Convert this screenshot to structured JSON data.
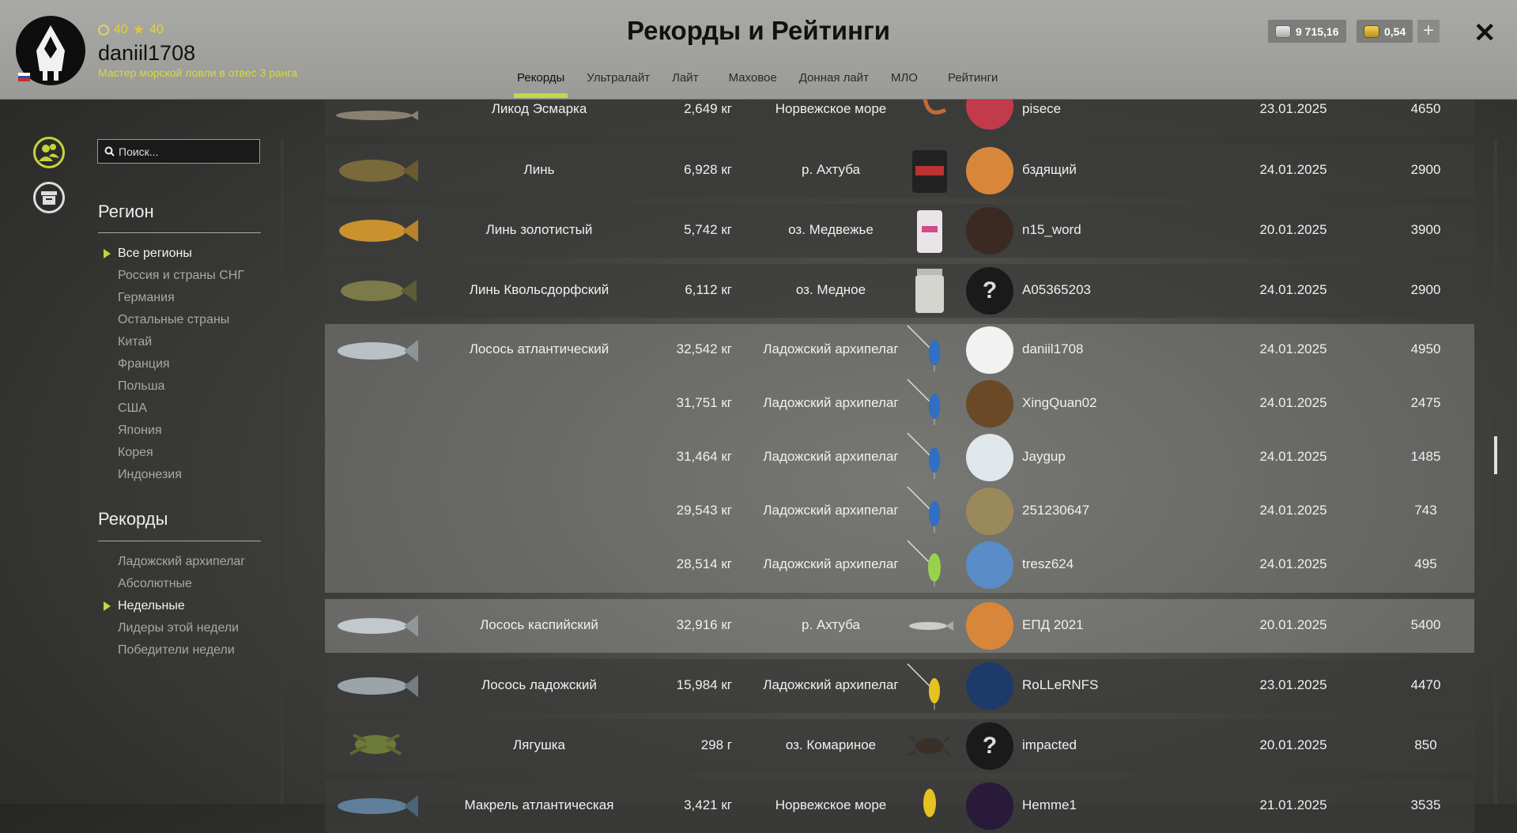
{
  "colors": {
    "accent": "#c6d33f",
    "header_bg": "#9f9f9c",
    "row_bg": "#3c3c3a"
  },
  "header": {
    "title": "Рекорды и Рейтинги",
    "level": "40",
    "stars": "40",
    "username": "daniil1708",
    "rank": "Мастер морской ловли в отвес 3 ранга",
    "silver": "9 715,16",
    "gold": "0,54",
    "plus_label": "+",
    "close_label": "✕",
    "tabs": [
      "Рекорды",
      "Ультралайт",
      "Лайт",
      "Маховое",
      "Донная лайт",
      "МЛО",
      "Рейтинги"
    ]
  },
  "sidebar": {
    "search_placeholder": "Поиск...",
    "region_title": "Регион",
    "regions": [
      "Все регионы",
      "Россия и страны СНГ",
      "Германия",
      "Остальные страны",
      "Китай",
      "Франция",
      "Польша",
      "США",
      "Япония",
      "Корея",
      "Индонезия"
    ],
    "records_title": "Рекорды",
    "records": [
      "Ладожский архипелаг",
      "Абсолютные",
      "Недельные",
      "Лидеры этой недели",
      "Победители недели"
    ]
  },
  "rows": [
    {
      "fish": "Ликод Эсмарка",
      "weight": "2,649 кг",
      "place": "Норвежское море",
      "player": "pisece",
      "date": "23.01.2025",
      "score": "4650"
    },
    {
      "fish": "Линь",
      "weight": "6,928 кг",
      "place": "р. Ахтуба",
      "player": "бздящий",
      "date": "24.01.2025",
      "score": "2900"
    },
    {
      "fish": "Линь золотистый",
      "weight": "5,742 кг",
      "place": "оз. Медвежье",
      "player": "n15_word",
      "date": "20.01.2025",
      "score": "3900"
    },
    {
      "fish": "Линь Квольсдорфский",
      "weight": "6,112 кг",
      "place": "оз. Медное",
      "player": "A05365203",
      "date": "24.01.2025",
      "score": "2900"
    },
    {
      "fish": "Лосось атлантический",
      "weight": "32,542 кг",
      "place": "Ладожский архипелаг",
      "player": "daniil1708",
      "date": "24.01.2025",
      "score": "4950"
    },
    {
      "fish": "",
      "weight": "31,751 кг",
      "place": "Ладожский архипелаг",
      "player": "XingQuan02",
      "date": "24.01.2025",
      "score": "2475"
    },
    {
      "fish": "",
      "weight": "31,464 кг",
      "place": "Ладожский архипелаг",
      "player": "Jaygup",
      "date": "24.01.2025",
      "score": "1485"
    },
    {
      "fish": "",
      "weight": "29,543 кг",
      "place": "Ладожский архипелаг",
      "player": "251230647",
      "date": "24.01.2025",
      "score": "743"
    },
    {
      "fish": "",
      "weight": "28,514 кг",
      "place": "Ладожский архипелаг",
      "player": "tresz624",
      "date": "24.01.2025",
      "score": "495"
    },
    {
      "fish": "Лосось каспийский",
      "weight": "32,916 кг",
      "place": "р. Ахтуба",
      "player": "ЕПД 2021",
      "date": "20.01.2025",
      "score": "5400"
    },
    {
      "fish": "Лосось ладожский",
      "weight": "15,984 кг",
      "place": "Ладожский архипелаг",
      "player": "RoLLeRNFS",
      "date": "23.01.2025",
      "score": "4470"
    },
    {
      "fish": "Лягушка",
      "weight": "298 г",
      "place": "оз. Комариное",
      "player": "impacted",
      "date": "20.01.2025",
      "score": "850"
    },
    {
      "fish": "Макрель атлантическая",
      "weight": "3,421 кг",
      "place": "Норвежское море",
      "player": "Hemme1",
      "date": "21.01.2025",
      "score": "3535"
    }
  ]
}
